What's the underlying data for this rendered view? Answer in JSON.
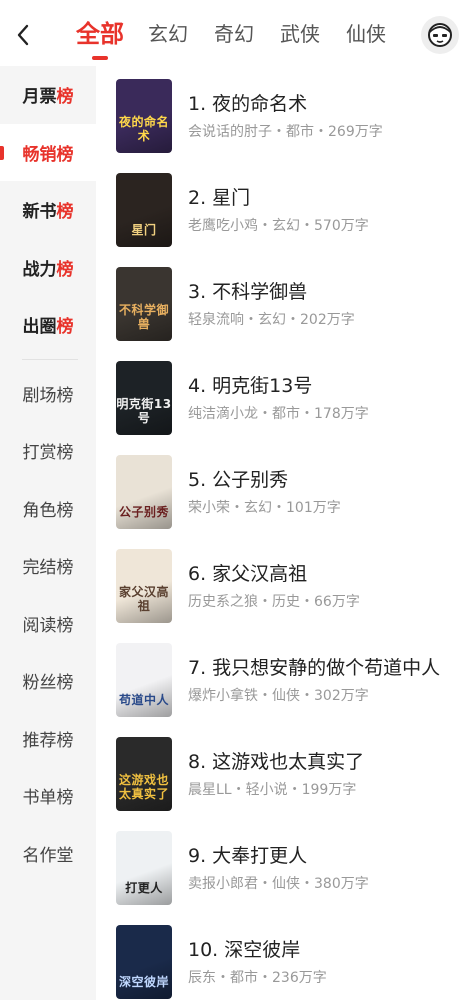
{
  "header": {
    "tabs": [
      {
        "label": "全部",
        "active": true
      },
      {
        "label": "玄幻"
      },
      {
        "label": "奇幻"
      },
      {
        "label": "武侠"
      },
      {
        "label": "仙侠"
      }
    ],
    "back_icon": "chevron-left-icon",
    "avatar_icon": "user-avatar-icon"
  },
  "sidebar": {
    "primary": [
      {
        "prefix": "月票",
        "suffix": "榜"
      },
      {
        "prefix": "畅销",
        "suffix": "榜",
        "active": true
      },
      {
        "prefix": "新书",
        "suffix": "榜"
      },
      {
        "prefix": "战力",
        "suffix": "榜"
      },
      {
        "prefix": "出圈",
        "suffix": "榜"
      }
    ],
    "secondary": [
      "剧场榜",
      "打赏榜",
      "角色榜",
      "完结榜",
      "阅读榜",
      "粉丝榜",
      "推荐榜",
      "书单榜",
      "名作堂"
    ]
  },
  "books": [
    {
      "title": "1. 夜的命名术",
      "meta": "会说话的肘子・都市・269万字",
      "cover_text": "夜的命名术"
    },
    {
      "title": "2. 星门",
      "meta": "老鹰吃小鸡・玄幻・570万字",
      "cover_text": "星门"
    },
    {
      "title": "3. 不科学御兽",
      "meta": "轻泉流响・玄幻・202万字",
      "cover_text": "不科学御兽"
    },
    {
      "title": "4. 明克街13号",
      "meta": "纯洁滴小龙・都市・178万字",
      "cover_text": "明克街13号"
    },
    {
      "title": "5. 公子别秀",
      "meta": "荣小荣・玄幻・101万字",
      "cover_text": "公子别秀"
    },
    {
      "title": "6. 家父汉高祖",
      "meta": "历史系之狼・历史・66万字",
      "cover_text": "家父汉高祖"
    },
    {
      "title": "7. 我只想安静的做个苟道中人",
      "meta": "爆炸小拿铁・仙侠・302万字",
      "cover_text": "苟道中人"
    },
    {
      "title": "8. 这游戏也太真实了",
      "meta": "晨星LL・轻小说・199万字",
      "cover_text": "这游戏也太真实了"
    },
    {
      "title": "9. 大奉打更人",
      "meta": "卖报小郎君・仙侠・380万字",
      "cover_text": "打更人"
    },
    {
      "title": "10. 深空彼岸",
      "meta": "辰东・都市・236万字",
      "cover_text": "深空彼岸"
    }
  ],
  "colors": {
    "accent": "#e8332b",
    "covers": [
      "#3a2a5a",
      "#2b2420",
      "#3a3530",
      "#1d2226",
      "#e9e2d6",
      "#efe6d8",
      "#f2f2f4",
      "#2a2a2a",
      "#eef1f3",
      "#1a2a4a"
    ],
    "cover_text": [
      "#ffd84a",
      "#f0d080",
      "#e8b060",
      "#f0f0f0",
      "#6a2020",
      "#5a4030",
      "#2a4a8a",
      "#f0c040",
      "#222222",
      "#c0d8ff"
    ]
  }
}
